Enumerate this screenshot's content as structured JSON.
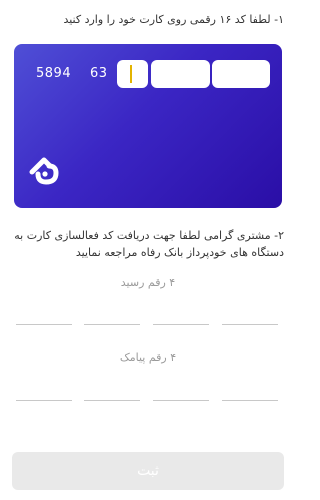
{
  "step1": {
    "title": "۱- لطفا کد ۱۶ رقمی روی کارت خود را وارد کنید"
  },
  "card": {
    "fixed_digits_1": "5894",
    "fixed_digits_2": "63",
    "pan_placeholder_1": "",
    "pan_placeholder_2": "",
    "pan_placeholder_3": "",
    "logo_icon": "bank-refah-logo-icon",
    "gradient_start": "#4f4fd6",
    "gradient_end": "#2a0ea6"
  },
  "step2": {
    "text": "۲- مشتری گرامی لطفا جهت دریافت کد فعالسازی کارت به دستگاه های خودپرداز بانک رفاه مراجعه نمایید"
  },
  "receipt": {
    "label": "۴ رقم رسید"
  },
  "sms": {
    "label": "۴ رقم پیامک"
  },
  "submit": {
    "label": "ثبت"
  }
}
